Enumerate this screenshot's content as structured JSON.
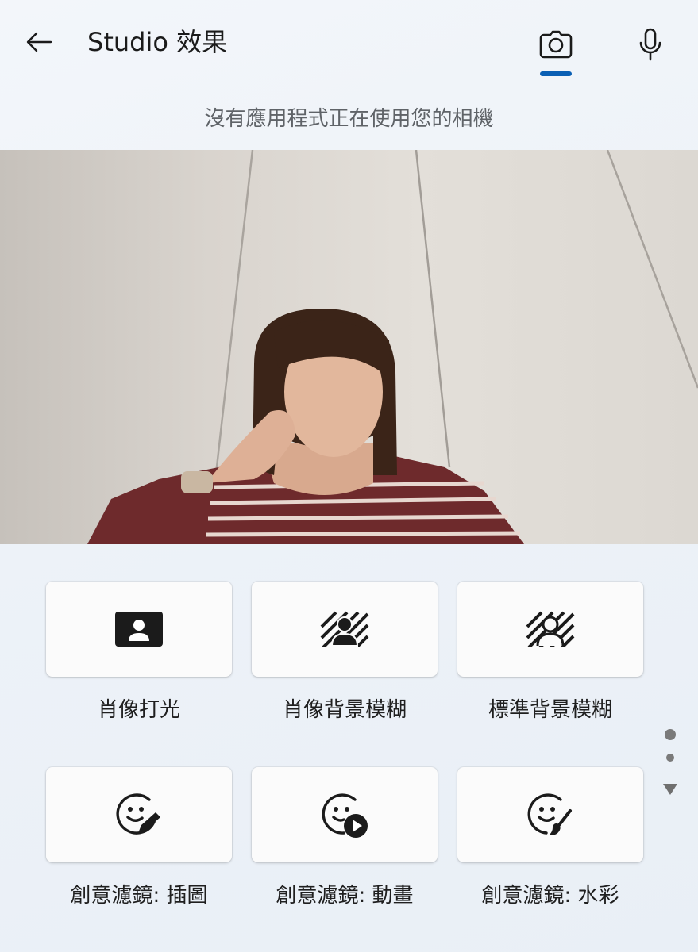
{
  "header": {
    "title": "Studio 效果",
    "tabs": [
      {
        "icon": "camera-icon",
        "selected": true
      },
      {
        "icon": "microphone-icon",
        "selected": false
      }
    ],
    "accent_color": "#0a5fb4"
  },
  "status_text": "沒有應用程式正在使用您的相機",
  "preview": {
    "description_icon": "camera-preview"
  },
  "effects": [
    {
      "label": "肖像打光",
      "icon": "portrait-light-icon"
    },
    {
      "label": "肖像背景模糊",
      "icon": "portrait-blur-icon"
    },
    {
      "label": "標準背景模糊",
      "icon": "standard-blur-icon"
    },
    {
      "label": "創意濾鏡: 插圖",
      "icon": "filter-illustrated-icon"
    },
    {
      "label": "創意濾鏡: 動畫",
      "icon": "filter-animated-icon"
    },
    {
      "label": "創意濾鏡: 水彩",
      "icon": "filter-watercolor-icon"
    }
  ],
  "pager": {
    "page_count": 2,
    "current_page": 1
  }
}
